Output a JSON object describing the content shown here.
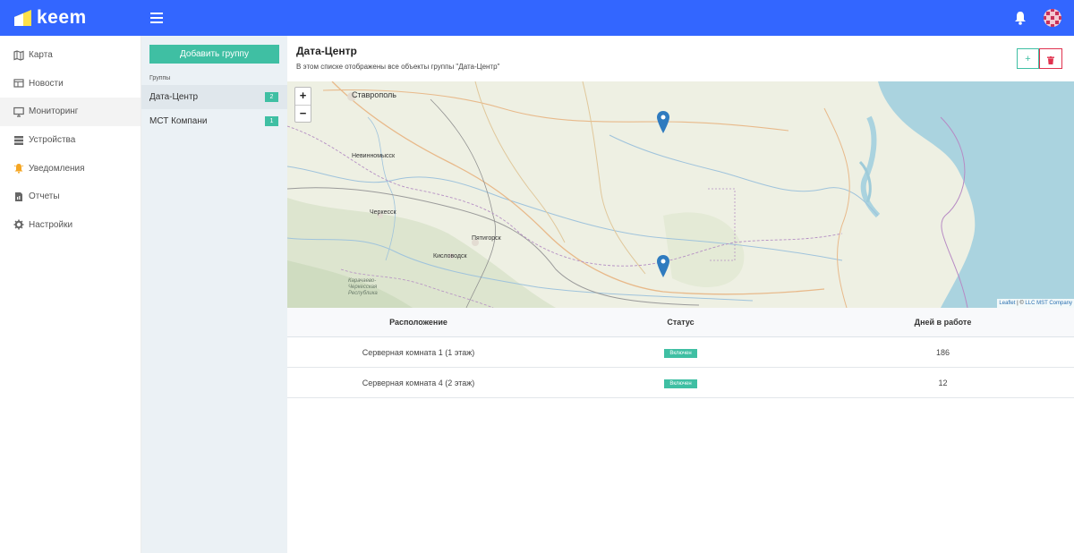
{
  "app": {
    "name": "keem"
  },
  "sidebar": {
    "items": [
      {
        "label": "Карта",
        "icon": "map-icon"
      },
      {
        "label": "Новости",
        "icon": "news-icon"
      },
      {
        "label": "Мониторинг",
        "icon": "monitor-icon"
      },
      {
        "label": "Устройства",
        "icon": "devices-icon"
      },
      {
        "label": "Уведомления",
        "icon": "bell-icon"
      },
      {
        "label": "Отчеты",
        "icon": "report-icon"
      },
      {
        "label": "Настройки",
        "icon": "gear-icon"
      }
    ]
  },
  "groups": {
    "add_label": "Добавить группу",
    "section_label": "Группы",
    "items": [
      {
        "name": "Дата-Центр",
        "count": "2"
      },
      {
        "name": "МСТ Компани",
        "count": "1"
      }
    ]
  },
  "main": {
    "title": "Дата-Центр",
    "subtitle": "В этом списке отображены все объекты группы \"Дата-Центр\"",
    "add_label": "+"
  },
  "map": {
    "zoom_in": "+",
    "zoom_out": "−",
    "labels": {
      "stavropol": "Ставрополь",
      "nevinnomyssk": "Невинномысск",
      "cherkessk": "Черкесск",
      "pyatigorsk": "Пятигорск",
      "kislovodsk": "Кисловодск",
      "kchr_1": "Карачаево-",
      "kchr_2": "Черкесская",
      "kchr_3": "Республика"
    },
    "attribution": {
      "leaflet": "Leaflet",
      "sep": " | © ",
      "provider": "LLC MST Company"
    }
  },
  "table": {
    "headers": [
      "Расположение",
      "Статус",
      "Дней в работе"
    ],
    "rows": [
      {
        "location": "Серверная комната 1 (1 этаж)",
        "status": "Включен",
        "days": "186"
      },
      {
        "location": "Серверная комната 4 (2 этаж)",
        "status": "Включен",
        "days": "12"
      }
    ]
  },
  "colors": {
    "topbar": "#3366ff",
    "accent": "#3fbfa3",
    "danger": "#e0324e",
    "marker": "#2f7bbf"
  }
}
